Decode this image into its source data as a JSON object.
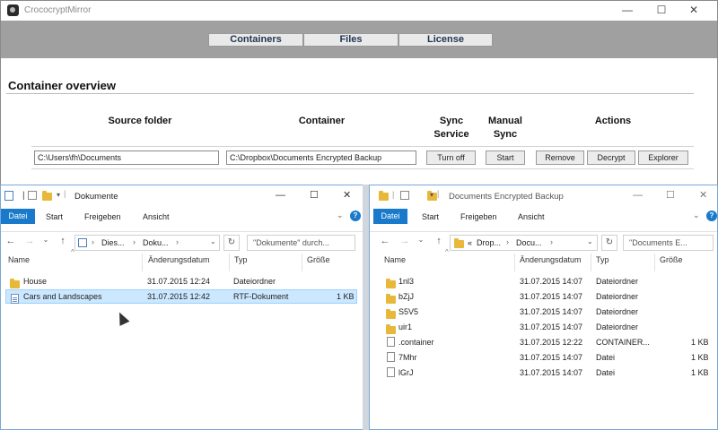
{
  "croco": {
    "title": "CrococryptMirror",
    "tabs": [
      "Containers",
      "Files",
      "License"
    ],
    "heading": "Container overview",
    "columns": {
      "source_folder": "Source folder",
      "container": "Container",
      "sync_service_1": "Sync",
      "sync_service_2": "Service",
      "manual_sync_1": "Manual",
      "manual_sync_2": "Sync",
      "actions": "Actions"
    },
    "row": {
      "source": "C:\\Users\\fh\\Documents",
      "container": "C:\\Dropbox\\Documents Encrypted Backup",
      "turn_off": "Turn off",
      "start": "Start",
      "remove": "Remove",
      "decrypt": "Decrypt",
      "explorer": "Explorer"
    },
    "window_controls": {
      "minimize": "—",
      "maximize": "☐",
      "close": "✕"
    }
  },
  "left": {
    "title": "Dokumente",
    "ribbon": [
      "Datei",
      "Start",
      "Freigeben",
      "Ansicht"
    ],
    "address": [
      "Dies...",
      "Doku..."
    ],
    "search": "\"Dokumente\" durch...",
    "headers": {
      "name": "Name",
      "date": "Änderungsdatum",
      "type": "Typ",
      "size": "Größe"
    },
    "files": [
      {
        "name": "House",
        "date": "31.07.2015 12:24",
        "type": "Dateiordner",
        "size": "",
        "icon": "folder-icon"
      },
      {
        "name": "Cars and Landscapes",
        "date": "31.07.2015 12:42",
        "type": "RTF-Dokument",
        "size": "1 KB",
        "icon": "document-icon"
      }
    ]
  },
  "right": {
    "title": "Documents Encrypted Backup",
    "ribbon": [
      "Datei",
      "Start",
      "Freigeben",
      "Ansicht"
    ],
    "address": [
      "«",
      "Drop...",
      "Docu..."
    ],
    "search": "\"Documents E...",
    "headers": {
      "name": "Name",
      "date": "Änderungsdatum",
      "type": "Typ",
      "size": "Größe"
    },
    "files": [
      {
        "name": "1nl3",
        "date": "31.07.2015 14:07",
        "type": "Dateiordner",
        "size": "",
        "icon": "folder-icon"
      },
      {
        "name": "bZjJ",
        "date": "31.07.2015 14:07",
        "type": "Dateiordner",
        "size": "",
        "icon": "folder-icon"
      },
      {
        "name": "S5V5",
        "date": "31.07.2015 14:07",
        "type": "Dateiordner",
        "size": "",
        "icon": "folder-icon"
      },
      {
        "name": "uir1",
        "date": "31.07.2015 14:07",
        "type": "Dateiordner",
        "size": "",
        "icon": "folder-icon"
      },
      {
        "name": ".container",
        "date": "31.07.2015 12:22",
        "type": "CONTAINER...",
        "size": "1 KB",
        "icon": "file-icon"
      },
      {
        "name": "7Mhr",
        "date": "31.07.2015 14:07",
        "type": "Datei",
        "size": "1 KB",
        "icon": "file-icon"
      },
      {
        "name": "lGrJ",
        "date": "31.07.2015 14:07",
        "type": "Datei",
        "size": "1 KB",
        "icon": "file-icon"
      }
    ]
  }
}
